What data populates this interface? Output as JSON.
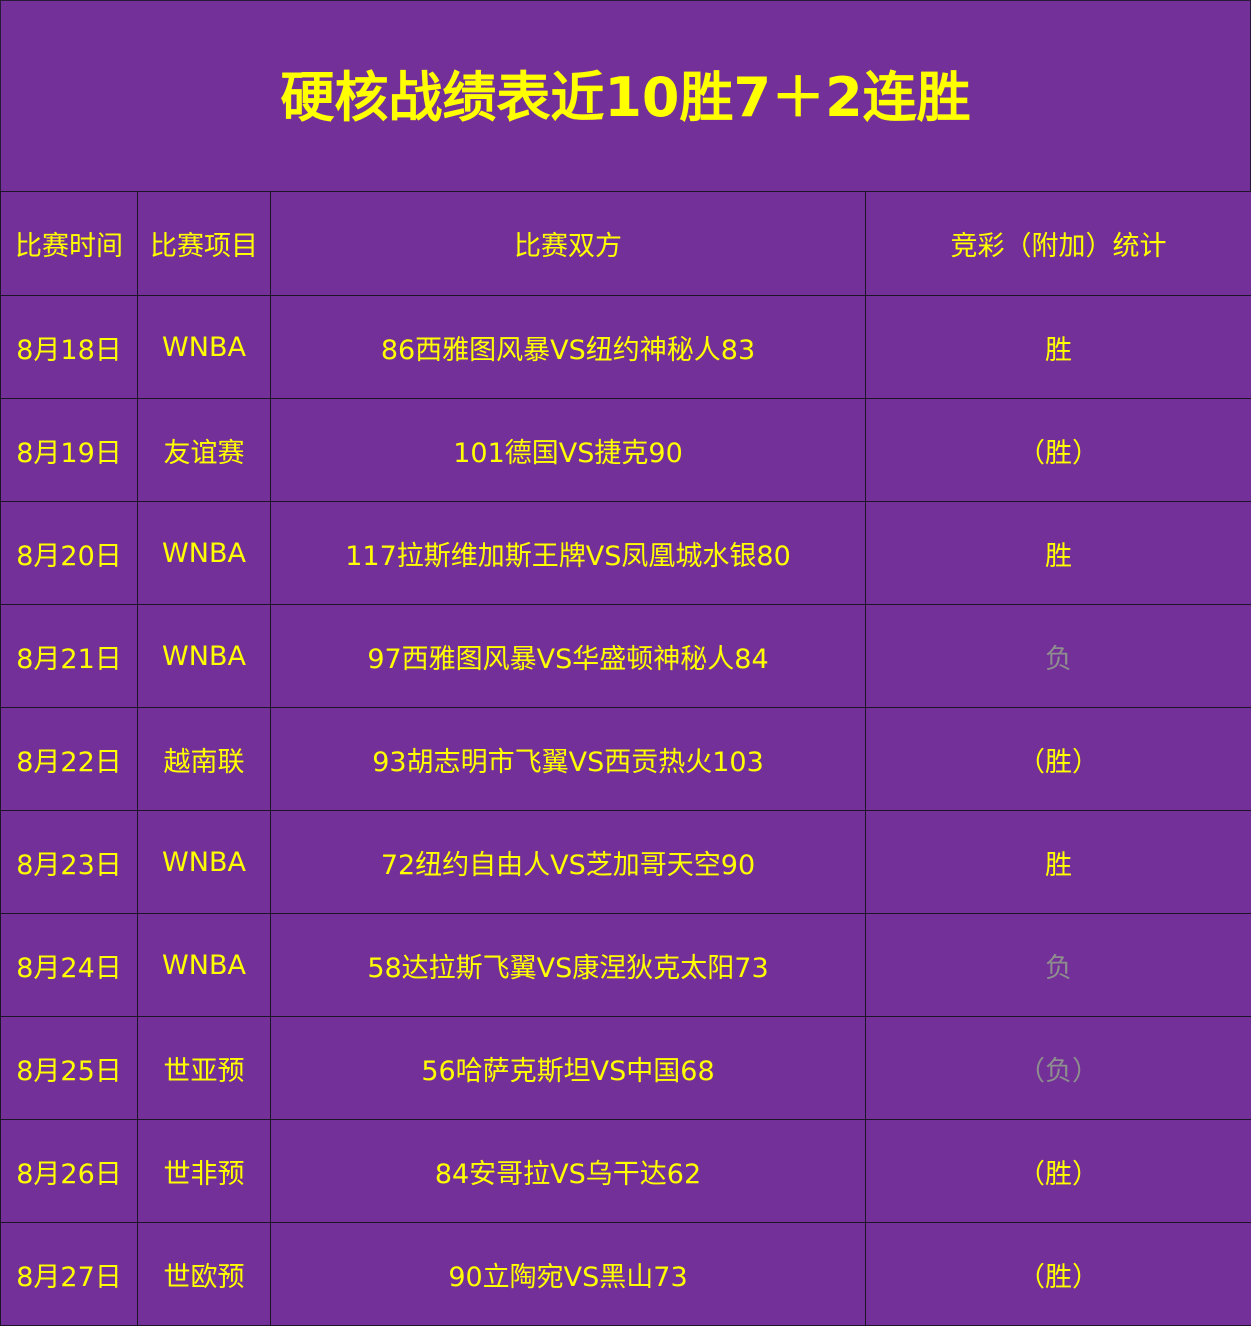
{
  "title": "硬核战绩表近10胜7＋2连胜",
  "colors": {
    "background": "#733098",
    "text": "#ffff00",
    "loss_text": "#8e8e8e",
    "grid_line": "#1e1428"
  },
  "table": {
    "headers": [
      "比赛时间",
      "比赛项目",
      "比赛双方",
      "竞彩（附加）统计"
    ],
    "rows": [
      {
        "date": "8月18日",
        "event": "WNBA",
        "match": "86西雅图风暴VS纽约神秘人83",
        "result": "胜",
        "is_loss": false
      },
      {
        "date": "8月19日",
        "event": "友谊赛",
        "match": "101德国VS捷克90",
        "result": "（胜）",
        "is_loss": false
      },
      {
        "date": "8月20日",
        "event": "WNBA",
        "match": "117拉斯维加斯王牌VS凤凰城水银80",
        "result": "胜",
        "is_loss": false
      },
      {
        "date": "8月21日",
        "event": "WNBA",
        "match": "97西雅图风暴VS华盛顿神秘人84",
        "result": "负",
        "is_loss": true
      },
      {
        "date": "8月22日",
        "event": "越南联",
        "match": "93胡志明市飞翼VS西贡热火103",
        "result": "（胜）",
        "is_loss": false
      },
      {
        "date": "8月23日",
        "event": "WNBA",
        "match": "72纽约自由人VS芝加哥天空90",
        "result": "胜",
        "is_loss": false
      },
      {
        "date": "8月24日",
        "event": "WNBA",
        "match": "58达拉斯飞翼VS康涅狄克太阳73",
        "result": "负",
        "is_loss": true
      },
      {
        "date": "8月25日",
        "event": "世亚预",
        "match": "56哈萨克斯坦VS中国68",
        "result": "（负）",
        "is_loss": true
      },
      {
        "date": "8月26日",
        "event": "世非预",
        "match": "84安哥拉VS乌干达62",
        "result": "（胜）",
        "is_loss": false
      },
      {
        "date": "8月27日",
        "event": "世欧预",
        "match": "90立陶宛VS黑山73",
        "result": "（胜）",
        "is_loss": false
      }
    ]
  }
}
